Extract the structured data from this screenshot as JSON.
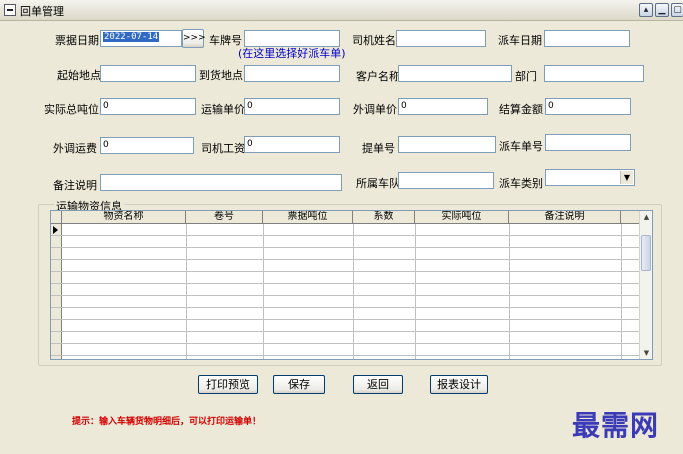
{
  "window": {
    "title": "回单管理",
    "minimize_glyph": "▴",
    "restore_glyph": "▁",
    "close_glyph": "▢"
  },
  "form": {
    "ticket_date_label": "票据日期",
    "ticket_date_value": "2022-07-14",
    "pick_button": ">>>",
    "plate_label": "车牌号",
    "plate_value": "",
    "plate_hint": "(在这里选择好派车单)",
    "driver_label": "司机姓名",
    "driver_value": "",
    "dispatch_date_label": "派车日期",
    "dispatch_date_value": "",
    "origin_label": "起始地点",
    "origin_value": "",
    "destination_label": "到货地点",
    "destination_value": "",
    "customer_label": "客户名称",
    "customer_value": "",
    "department_label": "部门",
    "department_value": "",
    "actual_tonnage_label": "实际总吨位",
    "actual_tonnage_value": "0",
    "freight_price_label": "运输单价",
    "freight_price_value": "0",
    "external_price_label": "外调单价",
    "external_price_value": "0",
    "settlement_label": "结算金额",
    "settlement_value": "0",
    "external_freight_label": "外调运费",
    "external_freight_value": "0",
    "driver_wage_label": "司机工资",
    "driver_wage_value": "0",
    "bill_no_label": "提单号",
    "bill_no_value": "",
    "dispatch_no_label": "派车单号",
    "dispatch_no_value": "",
    "remark_label": "备注说明",
    "remark_value": "",
    "fleet_label": "所属车队",
    "fleet_value": "",
    "dispatch_type_label": "派车类别",
    "dispatch_type_value": ""
  },
  "grid": {
    "group_title": "运输物资信息",
    "columns": [
      "物资名称",
      "卷号",
      "票据吨位",
      "系数",
      "实际吨位",
      "备注说明"
    ],
    "row_count": 12
  },
  "buttons": {
    "print_preview": "打印预览",
    "save": "保存",
    "back": "返回",
    "report_design": "报表设计"
  },
  "hint_text": "提示：输入车辆货物明细后，可以打印运输单！",
  "watermark": "最需网"
}
